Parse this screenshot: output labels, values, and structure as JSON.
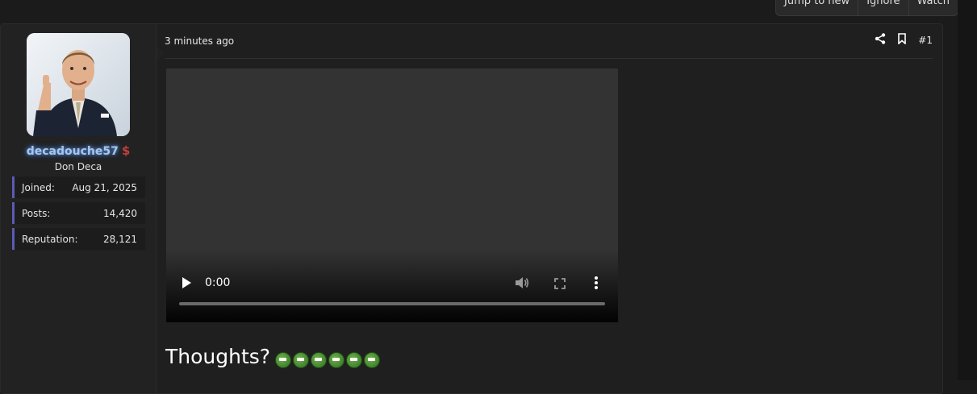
{
  "topbar": {
    "jump_label": "Jump to new",
    "ignore_label": "Ignore",
    "watch_label": "Watch"
  },
  "user": {
    "username": "decadouche57",
    "title": "Don Deca",
    "badge_icon": "dollar-sign-icon",
    "stats": [
      {
        "label": "Joined:",
        "value": "Aug 21, 2025"
      },
      {
        "label": "Posts:",
        "value": "14,420"
      },
      {
        "label": "Reputation:",
        "value": "28,121"
      }
    ]
  },
  "post": {
    "time": "3 minutes ago",
    "number": "#1",
    "share_icon": "share-icon",
    "bookmark_icon": "bookmark-icon",
    "video": {
      "current_time": "0:00",
      "progress": 0
    },
    "text": "Thoughts?",
    "emote_count": 6
  },
  "colors": {
    "username_glow": "#5b8fd8",
    "stat_accent": "#5b5bb5",
    "badge": "#c0403a"
  }
}
